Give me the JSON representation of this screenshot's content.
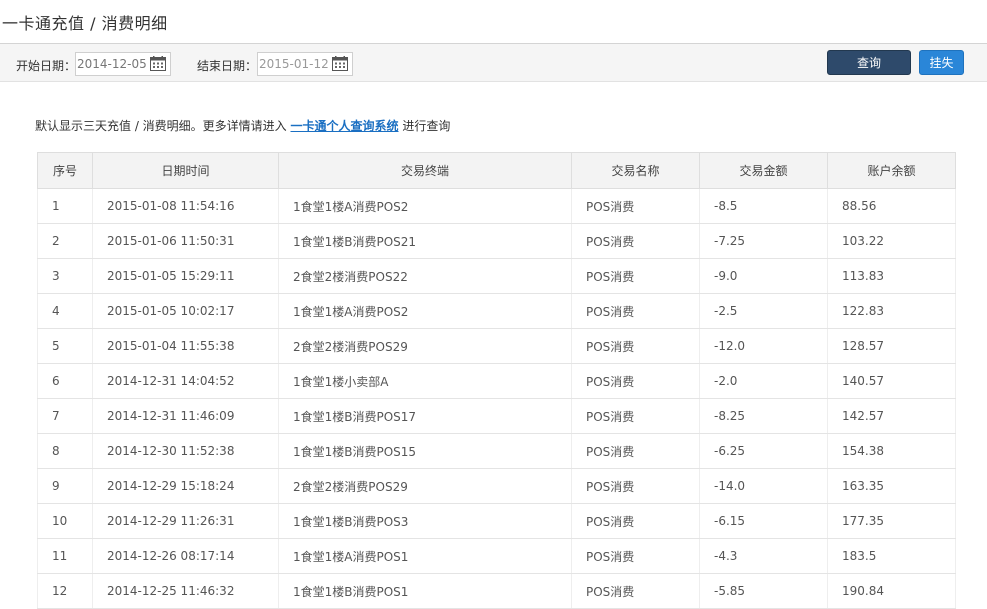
{
  "page": {
    "title": "一卡通充值 / 消费明细"
  },
  "filter": {
    "start_label": "开始日期：",
    "start_value": "2014-12-05",
    "end_label": "结束日期：",
    "end_value": "2015-01-12",
    "query_label": "查询",
    "lost_label": "挂失"
  },
  "notice": {
    "prefix": "默认显示三天充值 / 消费明细。更多详情请进入 ",
    "link": "一卡通个人查询系统",
    "suffix": " 进行查询"
  },
  "table": {
    "headers": [
      "序号",
      "日期时间",
      "交易终端",
      "交易名称",
      "交易金额",
      "账户余额"
    ],
    "rows": [
      [
        "1",
        "2015-01-08 11:54:16",
        "1食堂1楼A消费POS2",
        "POS消费",
        "-8.5",
        "88.56"
      ],
      [
        "2",
        "2015-01-06 11:50:31",
        "1食堂1楼B消费POS21",
        "POS消费",
        "-7.25",
        "103.22"
      ],
      [
        "3",
        "2015-01-05 15:29:11",
        "2食堂2楼消费POS22",
        "POS消费",
        "-9.0",
        "113.83"
      ],
      [
        "4",
        "2015-01-05 10:02:17",
        "1食堂1楼A消费POS2",
        "POS消费",
        "-2.5",
        "122.83"
      ],
      [
        "5",
        "2015-01-04 11:55:38",
        "2食堂2楼消费POS29",
        "POS消费",
        "-12.0",
        "128.57"
      ],
      [
        "6",
        "2014-12-31 14:04:52",
        "1食堂1楼小卖部A",
        "POS消费",
        "-2.0",
        "140.57"
      ],
      [
        "7",
        "2014-12-31 11:46:09",
        "1食堂1楼B消费POS17",
        "POS消费",
        "-8.25",
        "142.57"
      ],
      [
        "8",
        "2014-12-30 11:52:38",
        "1食堂1楼B消费POS15",
        "POS消费",
        "-6.25",
        "154.38"
      ],
      [
        "9",
        "2014-12-29 15:18:24",
        "2食堂2楼消费POS29",
        "POS消费",
        "-14.0",
        "163.35"
      ],
      [
        "10",
        "2014-12-29 11:26:31",
        "1食堂1楼B消费POS3",
        "POS消费",
        "-6.15",
        "177.35"
      ],
      [
        "11",
        "2014-12-26 08:17:14",
        "1食堂1楼A消费POS1",
        "POS消费",
        "-4.3",
        "183.5"
      ],
      [
        "12",
        "2014-12-25 11:46:32",
        "1食堂1楼B消费POS1",
        "POS消费",
        "-5.85",
        "190.84"
      ]
    ]
  },
  "icons": {
    "calendar": "calendar-icon"
  }
}
